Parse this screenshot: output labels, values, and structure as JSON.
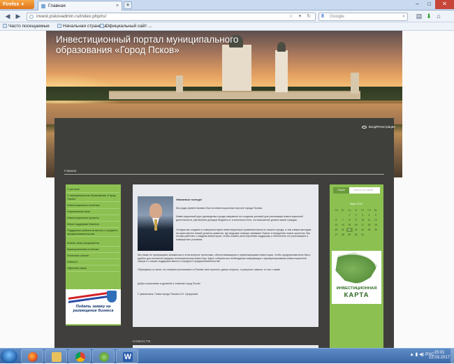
{
  "browser": {
    "menu_button": "Firefox",
    "tab_title": "Главная",
    "url": "invest.pskovadmin.ru/index.php/ru/",
    "search_placeholder": "Google",
    "bookmarks": [
      "Часто посещаемые",
      "Начальная страница",
      "Официальный сайт ..."
    ]
  },
  "site": {
    "title": "Инвестиционный портал муниципального образования «Город Псков»",
    "login": "Вход/Регистрация",
    "breadcrumb": "Главная",
    "left_menu": [
      "О регионе",
      "О муниципальном образовании «Город Псков»",
      "Инвестиционная политика",
      "Нормативная база",
      "Инвестиционные проекты",
      "Меры поддержки бизнеса",
      "Поддержка субъектов малого и среднего предпринимательства",
      "Бизнес-план предприятия",
      "Муниципальная политика",
      "Полезные ссылки",
      "Новости",
      "Обратная связь"
    ],
    "promo": "Подать заявку на размещение бизнеса",
    "greeting": "Уважаемые господа!",
    "paragraphs": [
      "Мы рады приветствовать Вас на инвестиционном портале города Пскова.",
      "Инвестиционный курс руководства города направлен на создание условий для реализации инвестиционной деятельности, увеличение доходов бюджета и, в конечном итоге, на повышение уровня жизни граждан.",
      "Сегодня мы создаем и совершенствуем инвестиционную привлекательность нашего города, и тем самым выходим на качественно новый уровень развития, где ведущие позиции занимают бизнес и внедрение новых проектов. Мы готовы работать с каждым инвестором, чтобы оказать всестороннюю поддержку и обеспечить его реализацию в комфортных условиях.",
      "Мы также не прекращаем заниматься в этом вопросе проектами, обеспечивающими и привлекающими инвестиции, чтобы предпринимателю было удобно для контактов каждому потенциальному инвестору. Здесь собрана вся необходимая информация о функционировании инвестиционной сферы и о мерах поддержки малого и среднего предпринимательства.",
      "Обращаюсь ко всем, кто намерен реализовать в Пскове свои проекты: двери открыты, а результат зависит от нас с вами!",
      "Добро пожаловать в древний и славный город Псков!",
      "С уважением, Глава города Пскова И.Н. Цецерский"
    ],
    "news_header": "НОВОСТИ",
    "search_button": "Поиск",
    "search_placeholder": "Искать на сайте",
    "calendar": {
      "month": "Март 2017",
      "weekdays": [
        "Пн",
        "Вт",
        "Ср",
        "Чт",
        "Пт",
        "Сб",
        "Вс"
      ],
      "days": [
        "",
        "",
        "1",
        "2",
        "3",
        "4",
        "5",
        "6",
        "7",
        "8",
        "9",
        "10",
        "11",
        "12",
        "13",
        "14",
        "15",
        "16",
        "17",
        "18",
        "19",
        "20",
        "21",
        "22",
        "23",
        "24",
        "25",
        "26",
        "27",
        "28",
        "29",
        "30",
        "31"
      ],
      "today": "22"
    },
    "map_banner": [
      "ИНВЕСТИЦИОННАЯ",
      "КАРТА"
    ]
  },
  "taskbar": {
    "language": "РУС",
    "time": "15:01",
    "date": "22.03.2017"
  }
}
